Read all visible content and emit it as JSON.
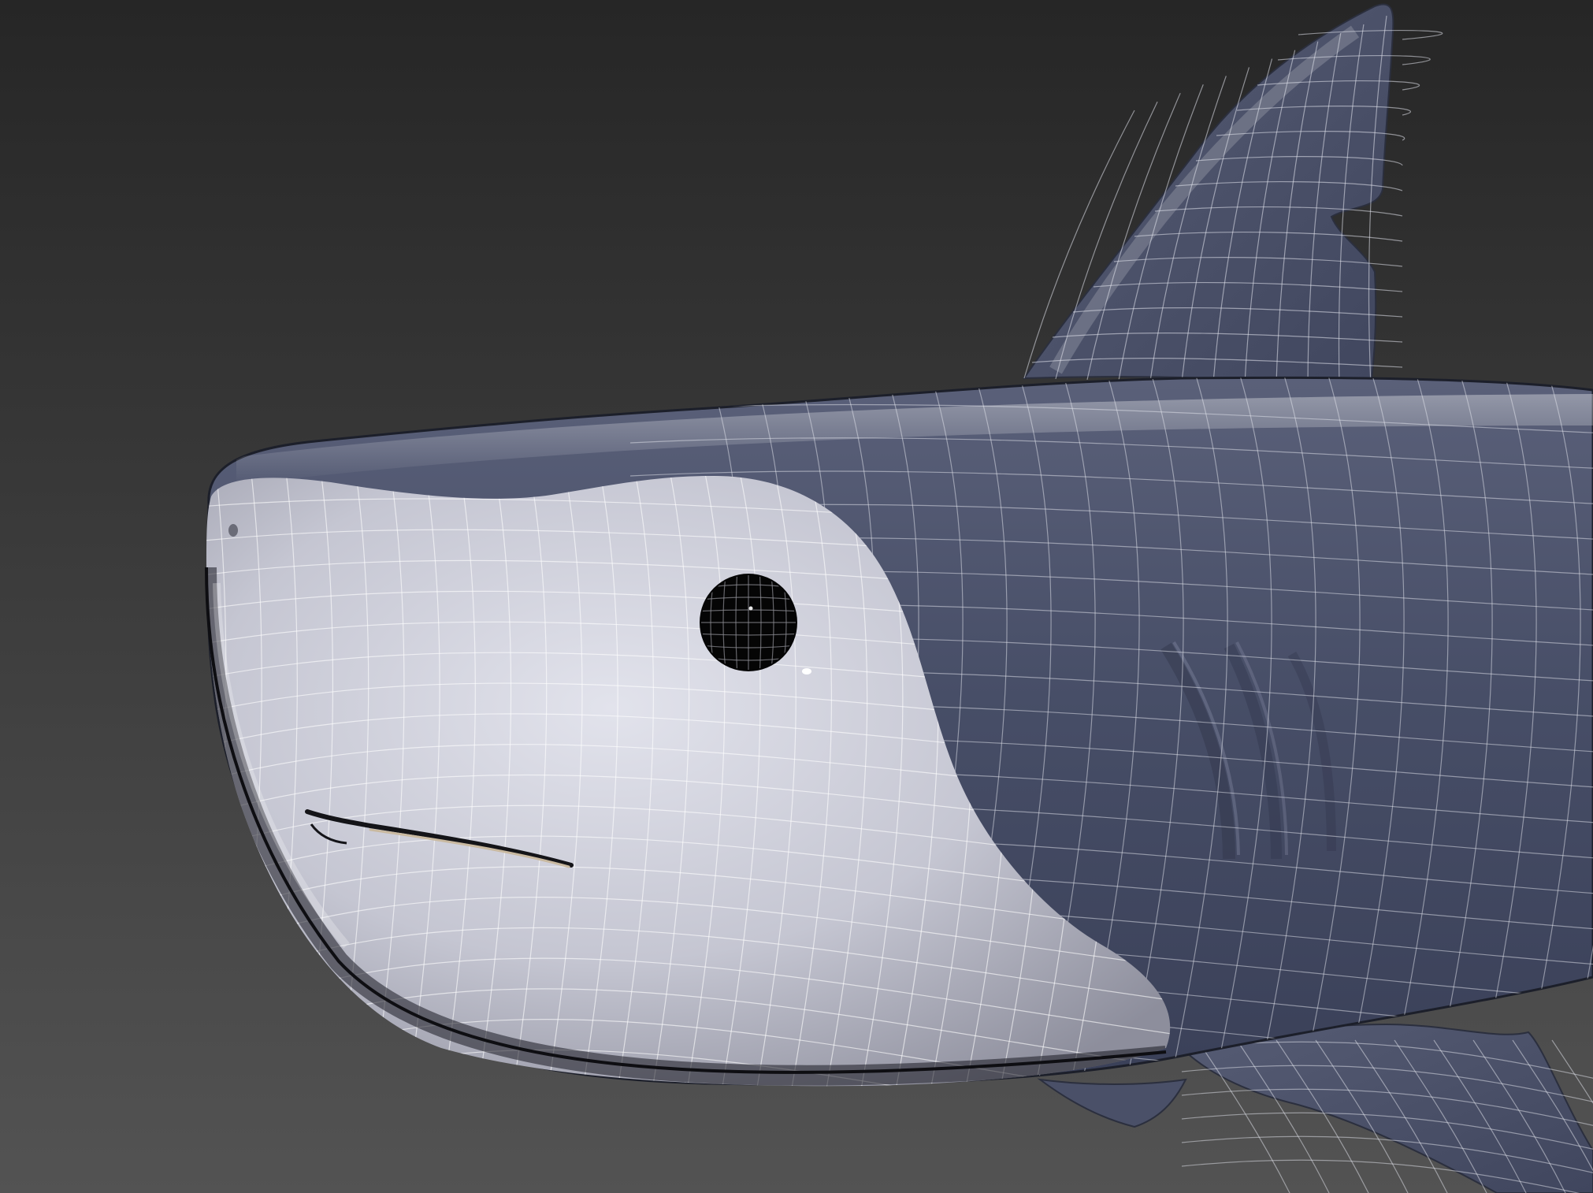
{
  "viewport": {
    "background_top": "#262626",
    "background_bottom": "#535353"
  },
  "model": {
    "subject": "shark-head-wireframe",
    "body_color": "#454c64",
    "belly_color": "#c7c8d4",
    "wire_color": "#e3e5ee",
    "eye_color": "#050505"
  }
}
